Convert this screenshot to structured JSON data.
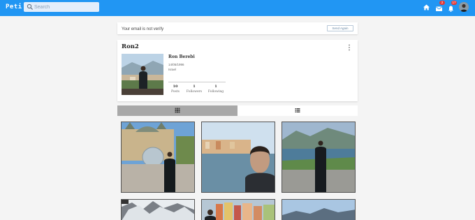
{
  "app": {
    "logo": "Peti"
  },
  "search": {
    "placeholder": "Search"
  },
  "nav": {
    "messages_count": "2",
    "notifications_count": "17"
  },
  "verify": {
    "message": "Your email is not verify",
    "button_label": "Send Again"
  },
  "profile": {
    "username": "Ron2",
    "full_name": "Ron Berebi",
    "birth_date": "14/05/1996",
    "country": "Israel",
    "stats": [
      {
        "value": "10",
        "label": "Posts"
      },
      {
        "value": "1",
        "label": "Followers"
      },
      {
        "value": "1",
        "label": "Following"
      }
    ]
  },
  "tabs": [
    {
      "icon": "grid-icon",
      "active": true
    },
    {
      "icon": "list-icon",
      "active": false
    }
  ],
  "posts": [
    {
      "name": "post-monaco-casino"
    },
    {
      "name": "post-selfie-sea-town"
    },
    {
      "name": "post-coast-view"
    },
    {
      "name": "post-snowy-mountain"
    },
    {
      "name": "post-colorful-village"
    },
    {
      "name": "post-lake-mountains"
    }
  ],
  "colors": {
    "appbar": "#2196f3",
    "badge": "#e53935",
    "active_tab": "#a8a8a8"
  }
}
